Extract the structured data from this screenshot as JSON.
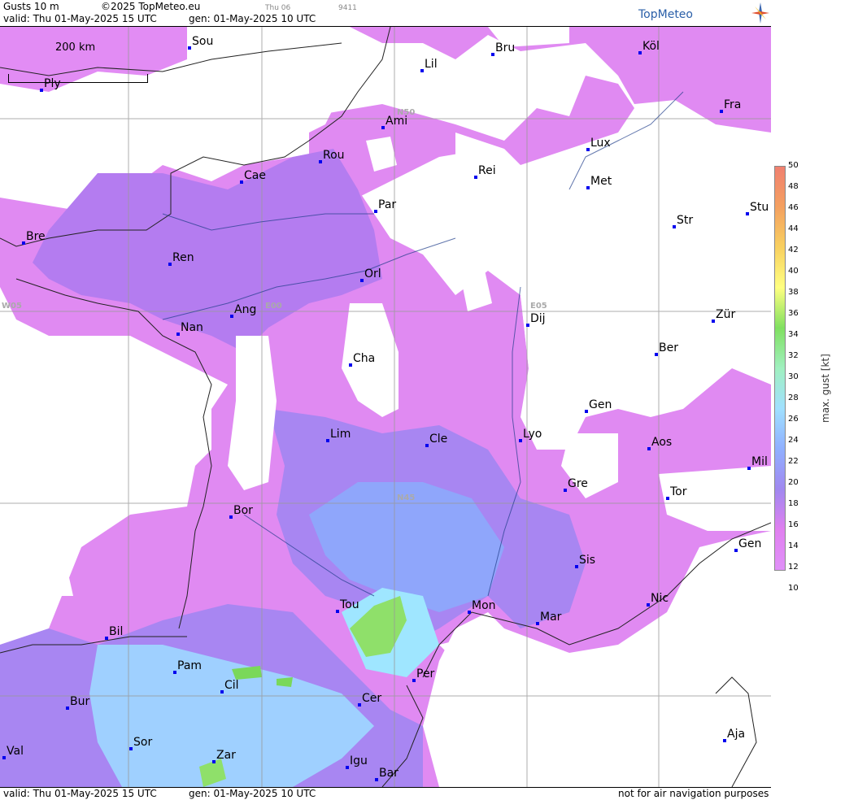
{
  "header": {
    "product": "Gusts 10 m",
    "copyright": "©2025 TopMeteo.eu",
    "day_tab": "Thu 06",
    "code": "9411",
    "valid_line": "valid:  Thu  01-May-2025  15 UTC",
    "gen_line": "gen: 01-May-2025 10 UTC",
    "brand": "TopMeteo"
  },
  "footer": {
    "valid_line": "valid:  Thu  01-May-2025  15 UTC",
    "gen_line": "gen: 01-May-2025 10 UTC",
    "notice": "not for air navigation purposes"
  },
  "scale": {
    "label": "200 km"
  },
  "grid_labels": [
    "N50",
    "N45",
    "W05",
    "E00",
    "E05"
  ],
  "legend": {
    "title": "max. gust  [kt]",
    "ticks": [
      "50",
      "48",
      "46",
      "44",
      "42",
      "40",
      "38",
      "36",
      "34",
      "32",
      "30",
      "28",
      "26",
      "24",
      "22",
      "20",
      "18",
      "16",
      "14",
      "12",
      "10"
    ],
    "colors": {
      "50": "#f08070",
      "46": "#f4a060",
      "42": "#f8d060",
      "38": "#ffff80",
      "34": "#80e060",
      "30": "#a0f0c0",
      "26": "#a0e0ff",
      "22": "#90b0ff",
      "18": "#a088f0",
      "14": "#e080f0",
      "12": "#e090f8"
    }
  },
  "cities": [
    {
      "name": "Sou"
    },
    {
      "name": "Bru"
    },
    {
      "name": "Köl"
    },
    {
      "name": "Ply"
    },
    {
      "name": "Lil"
    },
    {
      "name": "Fra"
    },
    {
      "name": "Ami"
    },
    {
      "name": "Lux"
    },
    {
      "name": "Rou"
    },
    {
      "name": "Cae"
    },
    {
      "name": "Rei"
    },
    {
      "name": "Met"
    },
    {
      "name": "Par"
    },
    {
      "name": "Str"
    },
    {
      "name": "Stu"
    },
    {
      "name": "Bre"
    },
    {
      "name": "Ren"
    },
    {
      "name": "Orl"
    },
    {
      "name": "Ang"
    },
    {
      "name": "Dij"
    },
    {
      "name": "Zür"
    },
    {
      "name": "Nan"
    },
    {
      "name": "Ber"
    },
    {
      "name": "Cha"
    },
    {
      "name": "Gen"
    },
    {
      "name": "Lim"
    },
    {
      "name": "Cle"
    },
    {
      "name": "Lyo"
    },
    {
      "name": "Aos"
    },
    {
      "name": "Mil"
    },
    {
      "name": "Gre"
    },
    {
      "name": "Tor"
    },
    {
      "name": "Bor"
    },
    {
      "name": "Gen"
    },
    {
      "name": "Sis"
    },
    {
      "name": "Nic"
    },
    {
      "name": "Tou"
    },
    {
      "name": "Mon"
    },
    {
      "name": "Mar"
    },
    {
      "name": "Bil"
    },
    {
      "name": "Pam"
    },
    {
      "name": "Cil"
    },
    {
      "name": "Per"
    },
    {
      "name": "Cer"
    },
    {
      "name": "Bur"
    },
    {
      "name": "Sor"
    },
    {
      "name": "Aja"
    },
    {
      "name": "Val"
    },
    {
      "name": "Zar"
    },
    {
      "name": "Igu"
    },
    {
      "name": "Bar"
    }
  ]
}
